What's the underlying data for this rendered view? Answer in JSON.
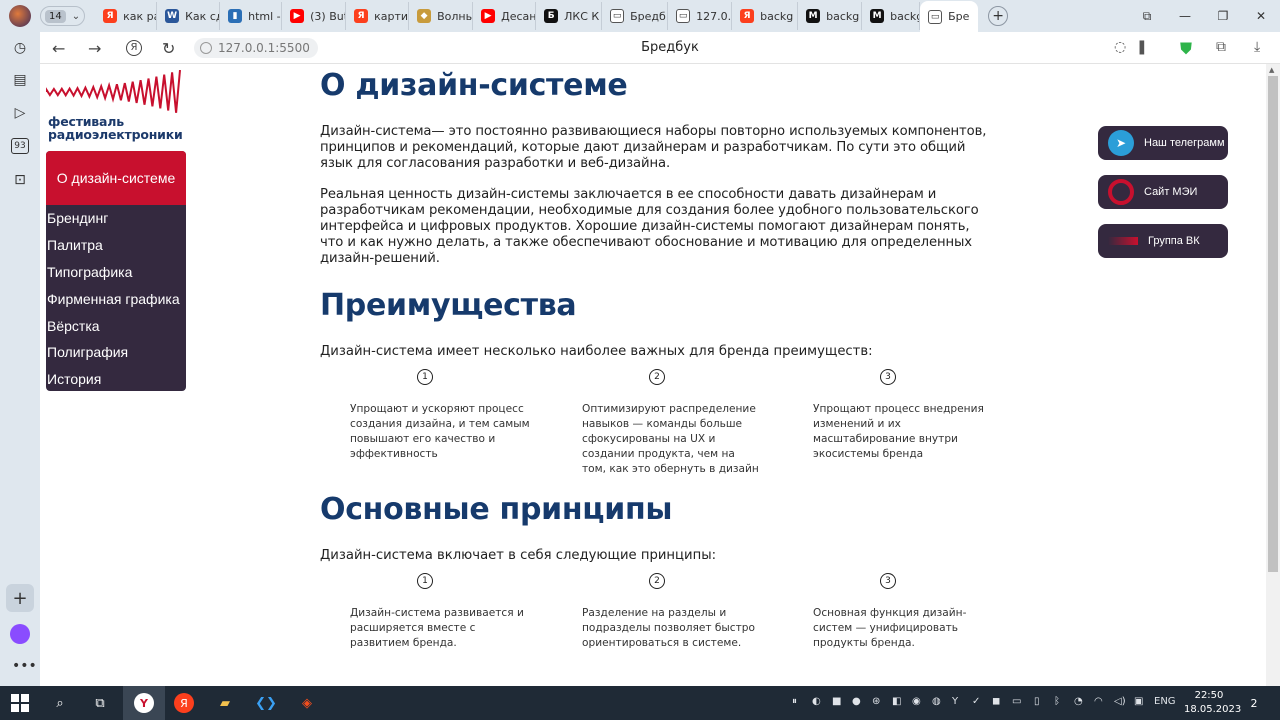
{
  "browser": {
    "tab_count": "14",
    "tabs": [
      {
        "label": "как ра",
        "fav": "Я",
        "color": "#fc3f1d"
      },
      {
        "label": "Как сд",
        "fav": "W",
        "color": "#2b579a"
      },
      {
        "label": "html -",
        "fav": "▮",
        "color": "#2b6fb6"
      },
      {
        "label": "(3) But",
        "fav": "▶",
        "color": "#ff0000"
      },
      {
        "label": "картин",
        "fav": "Я",
        "color": "#fc3f1d"
      },
      {
        "label": "Волны",
        "fav": "◆",
        "color": "#c89b3c"
      },
      {
        "label": "Десан",
        "fav": "▶",
        "color": "#ff0000"
      },
      {
        "label": "ЛКС К",
        "fav": "Б",
        "color": "#111111"
      },
      {
        "label": "Бредб",
        "fav": "▭",
        "color": "#ffffff"
      },
      {
        "label": "127.0.",
        "fav": "▭",
        "color": "#ffffff"
      },
      {
        "label": "backg",
        "fav": "Я",
        "color": "#fc3f1d"
      },
      {
        "label": "backg",
        "fav": "M",
        "color": "#111111"
      },
      {
        "label": "backg",
        "fav": "M",
        "color": "#111111"
      },
      {
        "label": "Бре",
        "fav": "▭",
        "color": "#ffffff",
        "active": true
      }
    ],
    "url": "127.0.0.1:5500",
    "page_title": "Бредбук",
    "sidebar_badge": "93"
  },
  "site": {
    "logo": {
      "line1": "фестиваль",
      "line2": "радиоэлектроники"
    },
    "menu": {
      "active": "О дизайн-системе",
      "items": [
        "Брендинг",
        "Палитра",
        "Типографика",
        "Фирменная графика",
        "Вёрстка",
        "Полиграфия",
        "История"
      ]
    },
    "social": [
      {
        "label": "Наш телеграмм",
        "icon": "telegram-icon"
      },
      {
        "label": "Сайт МЭИ",
        "icon": "mei-logo-icon"
      },
      {
        "label": "Группа ВК",
        "icon": "vk-icon"
      }
    ],
    "about": {
      "title": "О дизайн-системе",
      "p1": "Дизайн-система— это постоянно развивающиеся наборы повторно используемых компонентов, принципов и рекомендаций, которые дают дизайнерам и разработчикам. По сути это общий язык для согласования разработки и веб-дизайна.",
      "p2": "Реальная ценность дизайн-системы заключается в ее способности давать дизайнерам и разработчикам рекомендации, необходимые для создания более удобного пользовательского интерфейса и цифровых продуктов. Хорошие дизайн-системы помогают дизайнерам понять, что и как нужно делать, а также обеспечивают обоснование и мотивацию для определенных дизайн-решений."
    },
    "advantages": {
      "title": "Преимущества",
      "lead": "Дизайн-система имеет несколько наиболее важных для бренда преимуществ:",
      "items": [
        {
          "num": "1",
          "text": "Упрощают и ускоряют процесс создания дизайна, и тем самым повышают его качество и эффективность"
        },
        {
          "num": "2",
          "text": "Оптимизируют распределение навыков — команды больше сфокусированы на UX и создании продукта, чем на том, как это обернуть в дизайн"
        },
        {
          "num": "3",
          "text": "Упрощают процесс внедрения изменений и их масштабирование внутри экосистемы бренда"
        }
      ]
    },
    "principles": {
      "title": "Основные принципы",
      "lead": "Дизайн-система включает в себя следующие принципы:",
      "items": [
        {
          "num": "1",
          "text": "Дизайн-система развивается и расширяется вместе с развитием бренда."
        },
        {
          "num": "2",
          "text": "Разделение на разделы и подразделы позволяет быстро ориентироваться в системе."
        },
        {
          "num": "3",
          "text": "Основная функция дизайн-систем — унифицировать продукты бренда."
        }
      ]
    }
  },
  "taskbar": {
    "lang": "ENG",
    "time": "22:50",
    "date": "18.05.2023",
    "notif_count": "2"
  },
  "colors": {
    "accent_red": "#c8102e",
    "menu_dark": "#34293f",
    "heading_blue": "#163a6c"
  }
}
